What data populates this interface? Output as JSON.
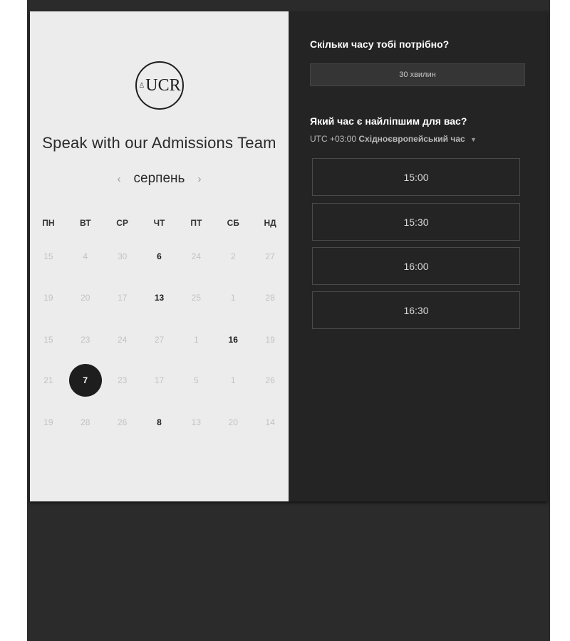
{
  "left": {
    "logo_text": "UCR",
    "title": "Speak with our Admissions Team",
    "month": "серпень",
    "weekdays": [
      "ПН",
      "ВТ",
      "СР",
      "ЧТ",
      "ПТ",
      "СБ",
      "НД"
    ],
    "weeks": [
      [
        "15",
        "4",
        "30",
        "6",
        "24",
        "2",
        "27"
      ],
      [
        "19",
        "20",
        "17",
        "13",
        "25",
        "1",
        "28"
      ],
      [
        "15",
        "23",
        "24",
        "27",
        "1",
        "16",
        "19"
      ],
      [
        "21",
        "7",
        "23",
        "17",
        "5",
        "1",
        "26"
      ],
      [
        "19",
        "28",
        "26",
        "8",
        "13",
        "20",
        "14"
      ]
    ],
    "available_days": [
      "6",
      "13",
      "16",
      "8"
    ],
    "selected_day": "7"
  },
  "right": {
    "duration_question": "Скільки часу тобі потрібно?",
    "duration_value": "30 хвилин",
    "time_question": "Який час є найліпшим для вас?",
    "timezone_offset": "UTC +03:00",
    "timezone_name": "Східноєвропейський час",
    "slots": [
      "15:00",
      "15:30",
      "16:00",
      "16:30"
    ]
  }
}
